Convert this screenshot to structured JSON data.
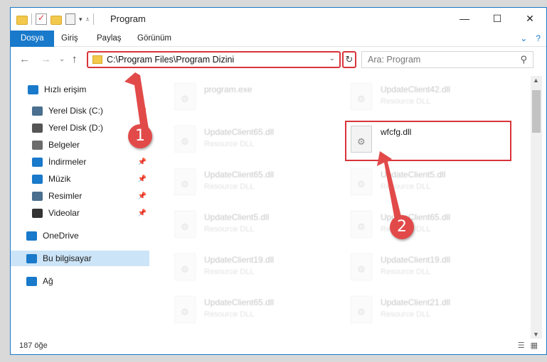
{
  "window": {
    "title": "Program",
    "controls": {
      "minimize": "—",
      "maximize": "☐",
      "close": "✕"
    }
  },
  "ribbon": {
    "tabs": [
      "Dosya",
      "Giriş",
      "Paylaş",
      "Görünüm"
    ],
    "expand_glyph": "⌄",
    "help_glyph": "?"
  },
  "navigation": {
    "back": "←",
    "forward": "→",
    "recent": "⌄",
    "up": "↑",
    "address_path": "C:\\Program Files\\Program Dizini",
    "address_dropdown": "⌄",
    "refresh": "↻",
    "search_placeholder": "Ara: Program",
    "search_icon": "⚲"
  },
  "sidebar": {
    "items": [
      {
        "label": "Hızlı erişim",
        "icon": "star-icon",
        "color": "#1979ca",
        "pinned": false
      },
      {
        "label": "Yerel Disk (C:)",
        "icon": "drive-icon",
        "color": "#4a6f8f",
        "pinned": true
      },
      {
        "label": "Yerel Disk (D:)",
        "icon": "drive-icon",
        "color": "#555555",
        "pinned": true
      },
      {
        "label": "Belgeler",
        "icon": "documents-icon",
        "color": "#6c6c6c",
        "pinned": true
      },
      {
        "label": "İndirmeler",
        "icon": "download-icon",
        "color": "#1979ca",
        "pinned": true
      },
      {
        "label": "Müzik",
        "icon": "music-icon",
        "color": "#1979ca",
        "pinned": true
      },
      {
        "label": "Resimler",
        "icon": "pictures-icon",
        "color": "#4a6f8f",
        "pinned": true
      },
      {
        "label": "Videolar",
        "icon": "videos-icon",
        "color": "#333333",
        "pinned": true
      },
      {
        "label": "OneDrive",
        "icon": "cloud-icon",
        "color": "#1979ca",
        "pinned": false
      },
      {
        "label": "Bu bilgisayar",
        "icon": "computer-icon",
        "color": "#1979ca",
        "pinned": false,
        "selected": true
      },
      {
        "label": "Ağ",
        "icon": "network-icon",
        "color": "#1979ca",
        "pinned": false
      }
    ],
    "pin_glyph": "📌"
  },
  "files": [
    {
      "name": "program.exe",
      "type": "",
      "faded": true
    },
    {
      "name": "UpdateClient42.dll",
      "type": "Resource DLL",
      "faded": true
    },
    {
      "name": "UpdateClient65.dll",
      "type": "Resource DLL",
      "faded": true
    },
    {
      "name": "wfcfg.dll",
      "type": "",
      "faded": false
    },
    {
      "name": "UpdateClient65.dll",
      "type": "Resource DLL",
      "faded": true
    },
    {
      "name": "UpdateClient5.dll",
      "type": "Resource DLL",
      "faded": true
    },
    {
      "name": "UpdateClient5.dll",
      "type": "Resource DLL",
      "faded": true
    },
    {
      "name": "UpdateClient65.dll",
      "type": "Resource DLL",
      "faded": true
    },
    {
      "name": "UpdateClient19.dll",
      "type": "Resource DLL",
      "faded": true
    },
    {
      "name": "UpdateClient19.dll",
      "type": "Resource DLL",
      "faded": true
    },
    {
      "name": "UpdateClient65.dll",
      "type": "Resource DLL",
      "faded": true
    },
    {
      "name": "UpdateClient21.dll",
      "type": "Resource DLL",
      "faded": true
    }
  ],
  "annotations": {
    "step1": "1",
    "step2": "2",
    "color": "#e24a4a"
  },
  "status": {
    "item_count": "187 öğe"
  },
  "colors": {
    "accent": "#1979ca",
    "highlight": "#d9343b",
    "selected_bg": "#cce4f7"
  }
}
